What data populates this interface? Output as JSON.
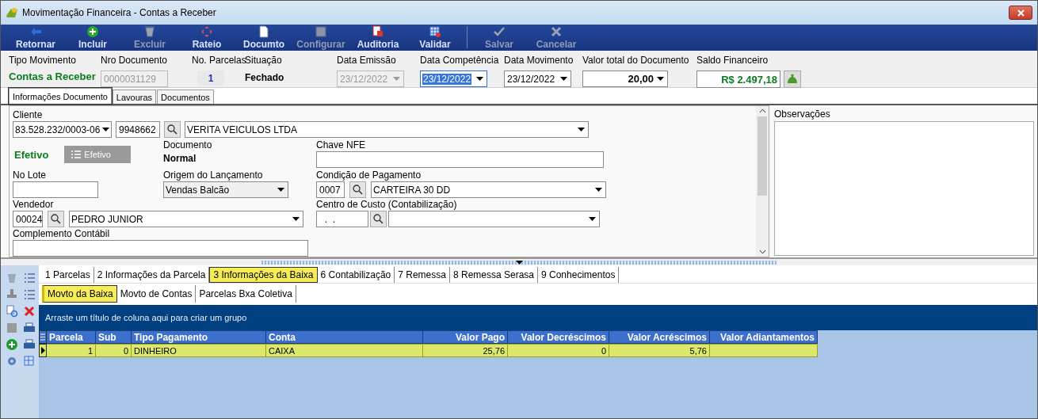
{
  "window": {
    "title": "Movimentação Financeira - Contas a Receber"
  },
  "toolbar": [
    {
      "label": "Retornar",
      "disabled": false
    },
    {
      "label": "Incluir",
      "disabled": false
    },
    {
      "label": "Excluir",
      "disabled": true
    },
    {
      "label": "Rateio",
      "disabled": false
    },
    {
      "label": "Documto",
      "disabled": false
    },
    {
      "label": "Configurar",
      "disabled": true
    },
    {
      "label": "Auditoria",
      "disabled": false
    },
    {
      "label": "Validar",
      "disabled": false
    },
    {
      "label": "Salvar",
      "disabled": true
    },
    {
      "label": "Cancelar",
      "disabled": true
    }
  ],
  "header": {
    "tipo_movimento": {
      "label": "Tipo Movimento",
      "value": "Contas a Receber"
    },
    "nro_documento": {
      "label": "Nro Documento",
      "value": "0000031129"
    },
    "no_parcelas": {
      "label": "No. Parcelas",
      "value": "1"
    },
    "situacao": {
      "label": "Situação",
      "value": "Fechado"
    },
    "data_emissao": {
      "label": "Data Emissão",
      "value": "23/12/2022",
      "disabled": true
    },
    "data_competencia": {
      "label": "Data Competência",
      "value": "23/12/2022",
      "focused": true
    },
    "data_movimento": {
      "label": "Data Movimento",
      "value": "23/12/2022"
    },
    "valor_total": {
      "label": "Valor total do Documento",
      "value": "20,00"
    },
    "saldo_financeiro": {
      "label": "Saldo Financeiro",
      "value": "R$ 2.497,18"
    }
  },
  "tabs": [
    {
      "label": "Informações Documento",
      "selected": true
    },
    {
      "label": "Lavouras",
      "selected": false
    },
    {
      "label": "Documentos",
      "selected": false
    }
  ],
  "form": {
    "cliente": {
      "label": "Cliente",
      "cnpj": "83.528.232/0003-06",
      "code": "9948662",
      "name": "VERITA VEICULOS LTDA"
    },
    "status": "Efetivo",
    "status_button": {
      "label": "Efetivo",
      "disabled": true
    },
    "documento": {
      "label": "Documento",
      "value": "Normal"
    },
    "chave_nfe": {
      "label": "Chave NFE"
    },
    "no_lote": {
      "label": "No Lote"
    },
    "origem": {
      "label": "Origem do Lançamento",
      "value": "Vendas Balcão"
    },
    "condicao": {
      "label": "Condição de Pagamento",
      "code": "0007",
      "name": "CARTEIRA 30 DD"
    },
    "vendedor": {
      "label": "Vendedor",
      "code": "00024",
      "name": "PEDRO JUNIOR"
    },
    "centro_custo": {
      "label": "Centro de Custo (Contabilização)",
      "code": "  .  ."
    },
    "complemento": {
      "label": "Complemento Contábil"
    }
  },
  "observacoes": {
    "label": "Observações"
  },
  "bottom_tabs": [
    {
      "label": "1 Parcelas",
      "selected": false
    },
    {
      "label": "2 Informações da Parcela",
      "selected": false
    },
    {
      "label": "3 Informações da Baixa",
      "selected": true
    },
    {
      "label": "6 Contabilização",
      "selected": false
    },
    {
      "label": "7 Remessa",
      "selected": false
    },
    {
      "label": "8 Remessa Serasa",
      "selected": false
    },
    {
      "label": "9 Conhecimentos",
      "selected": false
    }
  ],
  "sub_tabs": [
    {
      "label": "Movto da Baixa",
      "selected": true
    },
    {
      "label": "Movto de Contas",
      "selected": false
    },
    {
      "label": "Parcelas Bxa Coletiva",
      "selected": false
    }
  ],
  "grid": {
    "group_hint": "Arraste um título de coluna aqui para criar um grupo",
    "columns": [
      "Parcela",
      "Sub",
      "Tipo Pagamento",
      "Conta",
      "Valor Pago",
      "Valor Decréscimos",
      "Valor Acréscimos",
      "Valor Adiantamentos"
    ],
    "rows": [
      {
        "cells": [
          "1",
          "0",
          "DINHEIRO",
          "CAIXA",
          "25,76",
          "0",
          "5,76",
          ""
        ],
        "selected": true
      }
    ]
  }
}
